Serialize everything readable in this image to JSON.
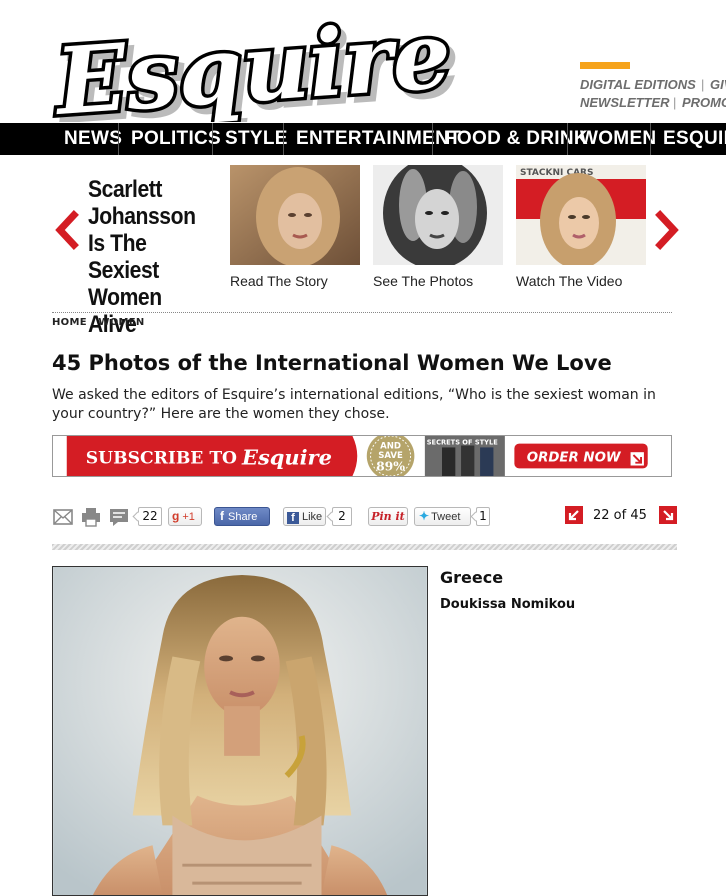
{
  "brand": {
    "logo_text": "Esquire",
    "accent_color": "#f6a31b",
    "red": "#d41d24"
  },
  "top_links": {
    "digital_editions": "DIGITAL EDITIONS",
    "sep": "|",
    "gi": "GIV",
    "newsletter": "NEWSLETTER",
    "promo": "PROMO"
  },
  "nav": {
    "items": [
      "NEWS",
      "POLITICS",
      "STYLE",
      "ENTERTAINMENT",
      "FOOD & DRINK",
      "WOMEN",
      "ESQUIRE"
    ]
  },
  "promo": {
    "headline": "Scarlett Johansson Is The Sexiest Women Alive",
    "cards": [
      {
        "caption": "Read The Story"
      },
      {
        "caption": "See The Photos"
      },
      {
        "caption": "Watch The Video"
      }
    ],
    "prev_icon": "chevron-left-icon",
    "next_icon": "chevron-right-icon"
  },
  "breadcrumb": "HOME / WOMEN",
  "article": {
    "title": "45 Photos of the International Women We Love",
    "dek": "We asked the editors of Esquire’s international editions, “Who is the sexiest woman in your country?” Here are the women they chose."
  },
  "banner": {
    "subscribe_text": "SUBSCRIBE TO",
    "brand": "Esquire",
    "badge_line1": "AND",
    "badge_line2": "SAVE",
    "badge_pct": "89%",
    "cover_text": "SECRETS OF STYLE",
    "order_text": "ORDER NOW"
  },
  "share": {
    "comment_count": "22",
    "gplus_label": "+1",
    "share_label": "Share",
    "like_label": "Like",
    "like_count": "2",
    "pin_label": "Pin it",
    "tweet_label": "Tweet",
    "tweet_count": "1",
    "icons": [
      "email-icon",
      "print-icon",
      "comment-icon"
    ]
  },
  "pager": {
    "text": "22 of 45",
    "current": 22,
    "total": 45
  },
  "slide": {
    "country": "Greece",
    "name": "Doukissa Nomikou"
  }
}
